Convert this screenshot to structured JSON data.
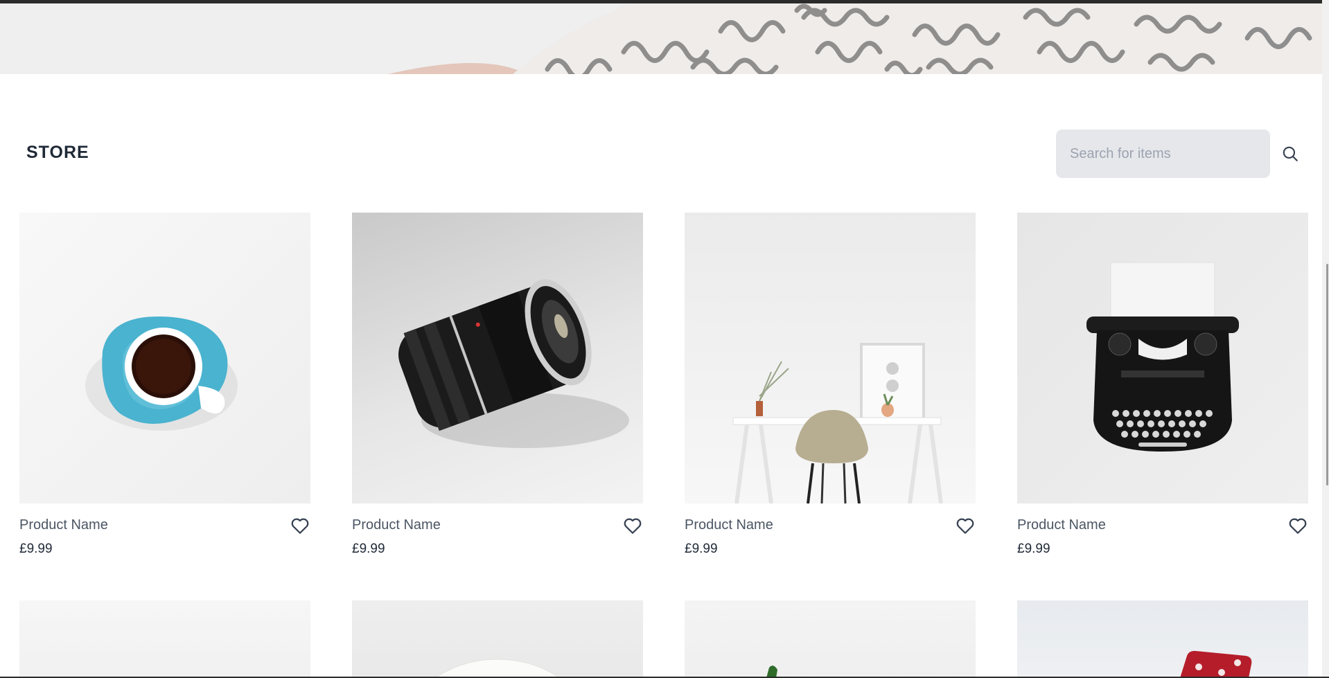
{
  "store": {
    "title": "STORE",
    "search_placeholder": "Search for items"
  },
  "products": [
    {
      "name": "Product Name",
      "price": "£9.99",
      "image": "coffee-cup"
    },
    {
      "name": "Product Name",
      "price": "£9.99",
      "image": "camera-lens"
    },
    {
      "name": "Product Name",
      "price": "£9.99",
      "image": "desk-chair"
    },
    {
      "name": "Product Name",
      "price": "£9.99",
      "image": "typewriter"
    }
  ],
  "next_row_images": [
    "white-object",
    "white-mug",
    "green-plant",
    "red-dice"
  ],
  "icons": {
    "search": "search-icon",
    "favorite": "heart-icon"
  },
  "colors": {
    "search_bg": "#e5e7eb",
    "text_dark": "#1f2937",
    "text_muted": "#4b5563"
  }
}
